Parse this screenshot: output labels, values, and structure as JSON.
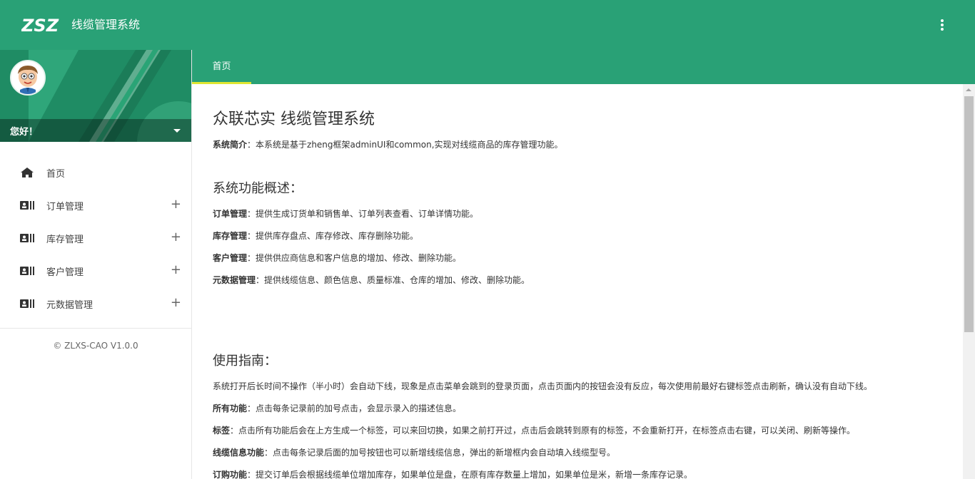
{
  "header": {
    "logo_text": "ZSZ",
    "app_title": "线缆管理系统"
  },
  "sidebar": {
    "greeting": "您好！",
    "items": [
      {
        "label": "首页",
        "icon": "home-icon",
        "expandable": false
      },
      {
        "label": "订单管理",
        "icon": "id-card-icon",
        "expandable": true
      },
      {
        "label": "库存管理",
        "icon": "id-card-icon",
        "expandable": true
      },
      {
        "label": "客户管理",
        "icon": "id-card-icon",
        "expandable": true
      },
      {
        "label": "元数据管理",
        "icon": "id-card-icon",
        "expandable": true
      }
    ],
    "expand_symbol": "+",
    "version": "© ZLXS-CAO V1.0.0"
  },
  "tabs": [
    {
      "label": "首页",
      "active": true
    }
  ],
  "content": {
    "title": "众联芯实 线缆管理系统",
    "intro": {
      "label": "系统简介",
      "text": "：本系统是基于zheng框架adminUI和common,实现对线缆商品的库存管理功能。"
    },
    "features": {
      "heading": "系统功能概述：",
      "items": [
        {
          "label": "订单管理",
          "text": "：提供生成订货单和销售单、订单列表查看、订单详情功能。"
        },
        {
          "label": "库存管理",
          "text": "：提供库存盘点、库存修改、库存删除功能。"
        },
        {
          "label": "客户管理",
          "text": "：提供供应商信息和客户信息的增加、修改、删除功能。"
        },
        {
          "label": "元数据管理",
          "text": "：提供线缆信息、颜色信息、质量标准、仓库的增加、修改、删除功能。"
        }
      ]
    },
    "guide": {
      "heading": "使用指南：",
      "plain": "系统打开后长时间不操作（半小时）会自动下线，现象是点击菜单会跳到的登录页面，点击页面内的按钮会没有反应，每次使用前最好右键标签点击刷新，确认没有自动下线。",
      "items": [
        {
          "label": "所有功能",
          "text": "：点击每条记录前的加号点击，会显示录入的描述信息。"
        },
        {
          "label": "标签",
          "text": "：点击所有功能后会在上方生成一个标签，可以来回切换，如果之前打开过，点击后会跳转到原有的标签，不会重新打开，在标签点击右键，可以关闭、刷新等操作。"
        },
        {
          "label": "线缆信息功能",
          "text": "：点击每条记录后面的加号按钮也可以新增线缆信息，弹出的新增框内会自动填入线缆型号。"
        },
        {
          "label": "订购功能",
          "text": "：提交订单后会根据线缆单位增加库存，如果单位是盘，在原有库存数量上增加，如果单位是米，新增一条库存记录。"
        }
      ]
    }
  },
  "colors": {
    "primary": "#29a176",
    "tab_underline": "#dfe631",
    "profile_bg": "#1f8c64"
  }
}
